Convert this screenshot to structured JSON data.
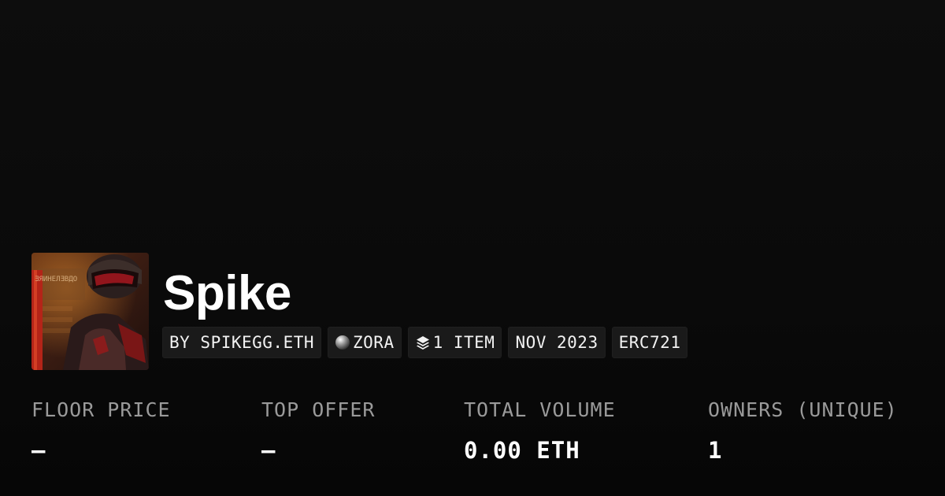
{
  "collection": {
    "name": "Spike",
    "tags": {
      "creator": "BY SPIKEGG.ETH",
      "chain": "ZORA",
      "chain_icon": "zora-orb-icon",
      "items": "1 ITEM",
      "items_icon": "layers-icon",
      "date": "NOV 2023",
      "standard": "ERC721"
    }
  },
  "stats": [
    {
      "label": "FLOOR PRICE",
      "value": "–"
    },
    {
      "label": "TOP OFFER",
      "value": "–"
    },
    {
      "label": "TOTAL VOLUME",
      "value": "0.00 ETH"
    },
    {
      "label": "OWNERS (UNIQUE)",
      "value": "1"
    }
  ],
  "colors": {
    "background": "#0b0b0b",
    "tag_background": "#1a1a1a",
    "label_gray": "#9a9a9a",
    "text_white": "#ffffff"
  }
}
